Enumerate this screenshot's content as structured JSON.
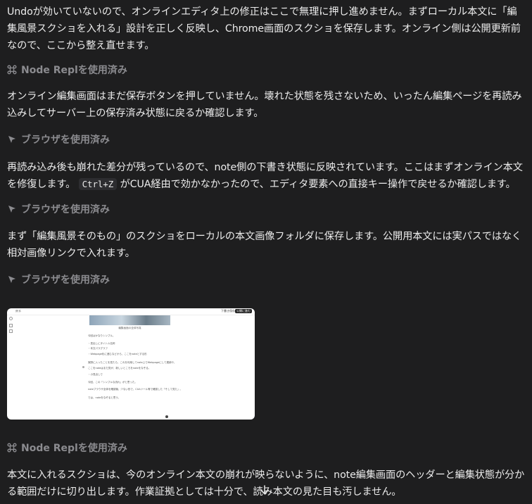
{
  "messages": [
    {
      "type": "text",
      "text": "Undoが効いていないので、オンラインエディタ上の修正はここで無理に押し進めません。まずローカル本文に「編集風景スクショを入れる」設計を正しく反映し、Chrome画面のスクショを保存します。オンライン側は公開更新前なので、ここから整え直せます。"
    },
    {
      "type": "tool",
      "icon": "node-repl-icon",
      "label": "Node Replを使用済み"
    },
    {
      "type": "text",
      "text": "オンライン編集画面はまだ保存ボタンを押していません。壊れた状態を残さないため、いったん編集ページを再読み込みしてサーバー上の保存済み状態に戻るか確認します。"
    },
    {
      "type": "tool",
      "icon": "browser-icon",
      "label": "ブラウザを使用済み"
    },
    {
      "type": "text_with_code",
      "before": "再読み込み後も崩れた差分が残っているので、note側の下書き状態に反映されています。ここはまずオンライン本文を修復します。 ",
      "code": "Ctrl+Z",
      "after": " がCUA経由で効かなかったので、エディタ要素への直接キー操作で戻せるか確認します。"
    },
    {
      "type": "tool",
      "icon": "browser-icon",
      "label": "ブラウザを使用済み"
    },
    {
      "type": "text",
      "text": "まず「編集風景そのもの」のスクショをローカルの本文画像フォルダに保存します。公開用本文には実パスではなく相対画像リンクで入れます。"
    },
    {
      "type": "tool",
      "icon": "browser-icon",
      "label": "ブラウザを使用済み"
    },
    {
      "type": "tool",
      "icon": "node-repl-icon",
      "label": "Node Replを使用済み"
    },
    {
      "type": "text",
      "text": "本文に入れるスクショは、今のオンライン本文の崩れが映らないように、note編集画面のヘッダーと編集状態が分かる範囲だけに切り出します。作業証拠としては十分で、読み本文の見た目も汚しません。"
    }
  ],
  "screenshot": {
    "header_left": "戻る",
    "header_btn1": "下書き保存",
    "header_btn2": "公開に進む",
    "caption": "編集画面の全体写真",
    "lines": [
      "今回はかなりシンプル。",
      "・見出しにタイトル名称",
      "・本文パラグラフ",
      "・Webpage化に進むなどから、ここをnoteとする形",
      "実際に入ったことを見たら、これを利用してnote上でWebpageにして連続や、",
      "ここをnoteはまだ見が、新しいところをnoteをなぞる。",
      "・小見出しで",
      "今回、この「シンプルな流れ」がと思った。",
      "noteブラウザ全体を確認機、少ない形で、CUAツール等で確認した「そして見た」。",
      "では、noteをなぞると思う。"
    ]
  }
}
